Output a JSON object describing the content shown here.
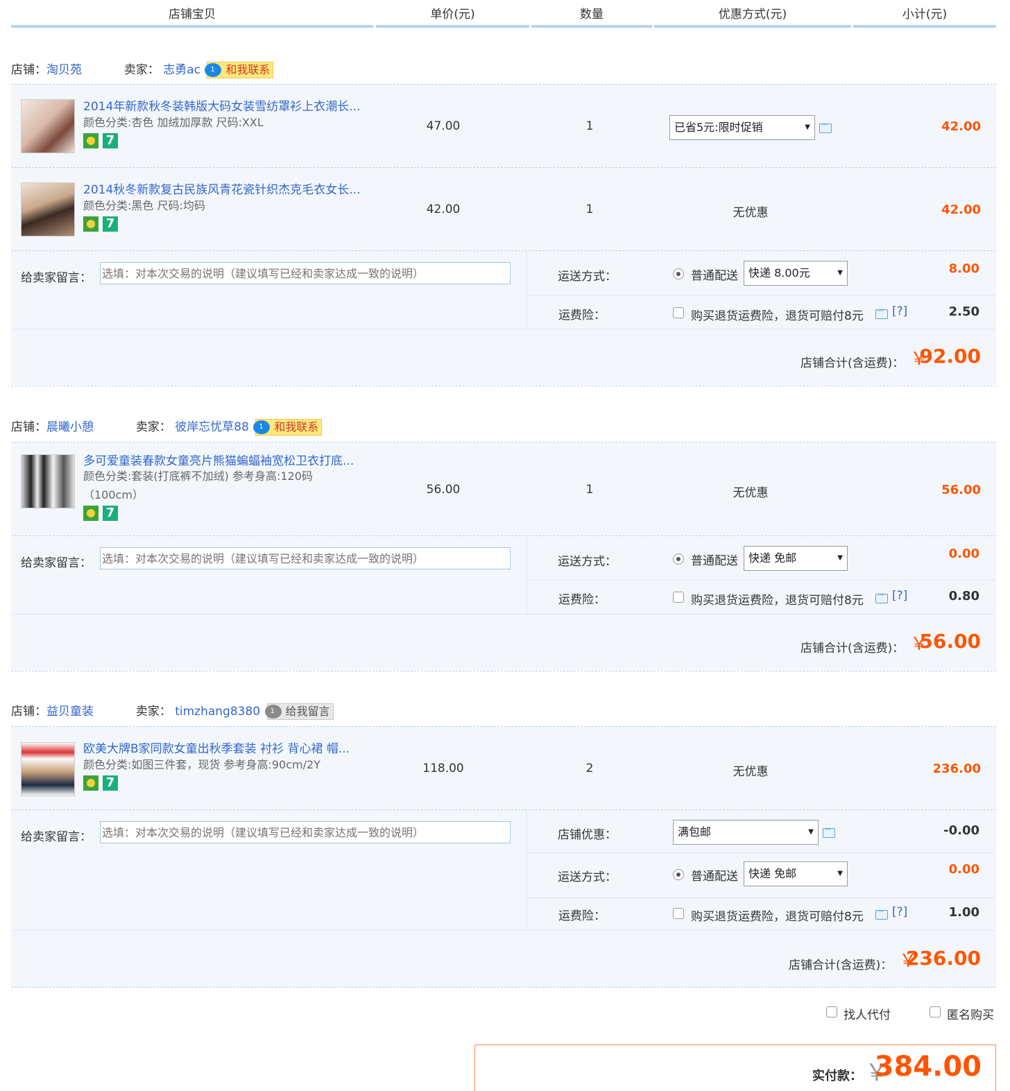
{
  "header": {
    "col_item": "店铺宝贝",
    "col_price": "单价(元)",
    "col_qty": "数量",
    "col_promo": "优惠方式(元)",
    "col_subtotal": "小计(元)"
  },
  "labels": {
    "shop": "店铺：",
    "seller": "卖家：",
    "message_label": "给卖家留言：",
    "message_placeholder": "选填：对本次交易的说明（建议填写已经和卖家达成一致的说明）",
    "shipping_label": "运送方式：",
    "shipping_option": "普通配送",
    "insurance_label": "运费险：",
    "insurance_text": "购买退货运费险，退货可赔付8元",
    "help": "[?]",
    "store_discount_label": "店铺优惠：",
    "shop_total_label": "店铺合计(含运费)：",
    "currency": "￥",
    "no_discount": "无优惠"
  },
  "shops": [
    {
      "shop_name": "淘贝苑",
      "seller_name": "志勇ac",
      "contact": "和我联系",
      "items": [
        {
          "title": "2014年新款秋冬装韩版大码女装雪纺罩衫上衣潮长...",
          "sku": "颜色分类:杏色 加绒加厚款   尺码:XXL",
          "price": "47.00",
          "qty": "1",
          "promo": "已省5元:限时促销",
          "subtotal": "42.00"
        },
        {
          "title": "2014秋冬新款复古民族风青花瓷针织杰克毛衣女长...",
          "sku": "颜色分类:黑色   尺码:均码",
          "price": "42.00",
          "qty": "1",
          "promo": "无优惠",
          "subtotal": "42.00"
        }
      ],
      "shipping_select": "快递 8.00元",
      "shipping_fee": "8.00",
      "insurance_fee": "2.50",
      "shop_total": "92.00"
    },
    {
      "shop_name": "晨曦小憩",
      "seller_name": "彼岸忘忧草88",
      "contact": "和我联系",
      "items": [
        {
          "title": "多可爱童装春款女童亮片熊猫蝙蝠袖宽松卫衣打底...",
          "sku_line1": "颜色分类:套装(打底裤不加绒)   参考身高:120码",
          "sku_line2": "（100cm）",
          "price": "56.00",
          "qty": "1",
          "promo": "无优惠",
          "subtotal": "56.00"
        }
      ],
      "shipping_select": "快递 免邮",
      "shipping_fee": "0.00",
      "insurance_fee": "0.80",
      "shop_total": "56.00"
    },
    {
      "shop_name": "益贝童装",
      "seller_name": "timzhang8380",
      "contact": "给我留言",
      "items": [
        {
          "title": "欧美大牌B家同款女童出秋季套装 衬衫 背心裙 帽...",
          "sku": "颜色分类:如图三件套，现货   参考身高:90cm/2Y",
          "price": "118.00",
          "qty": "2",
          "promo": "无优惠",
          "subtotal": "236.00"
        }
      ],
      "store_discount_select": "满包邮",
      "store_discount": "-0.00",
      "shipping_select": "快递 免邮",
      "shipping_fee": "0.00",
      "insurance_fee": "1.00",
      "shop_total": "236.00"
    }
  ],
  "options": {
    "proxy_pay": "找人代付",
    "anonymous": "匿名购买"
  },
  "payment": {
    "label": "实付款：",
    "currency": "￥",
    "amount": "384.00"
  },
  "colors": {
    "accent_orange": "#ff5500",
    "link_blue": "#3366cc",
    "row_bg": "#f3f7fc",
    "header_line": "#b8d3ee"
  }
}
